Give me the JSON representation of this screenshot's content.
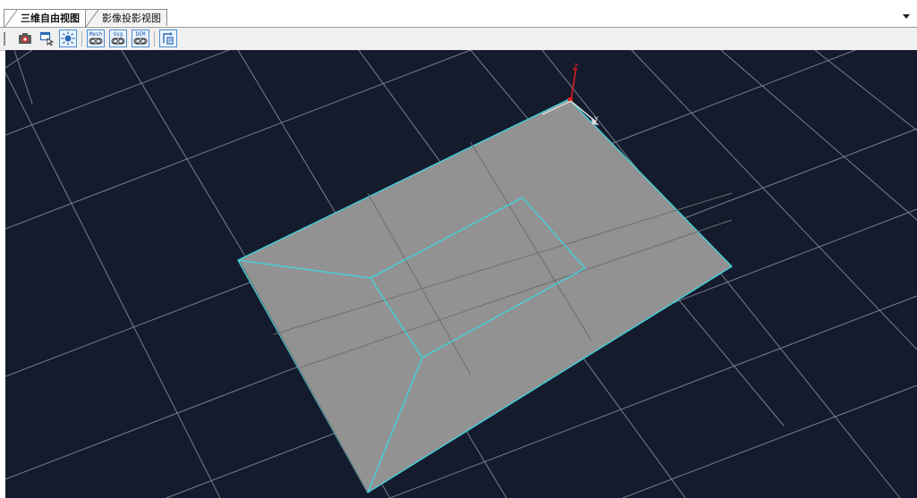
{
  "tabs": [
    {
      "label": "三维自由视图",
      "active": true
    },
    {
      "label": "影像投影视图",
      "active": false
    }
  ],
  "toolbar": {
    "buttons": [
      {
        "name": "snapshot-button",
        "icon": "camera-icon"
      },
      {
        "name": "select-button",
        "icon": "select-cursor-icon"
      },
      {
        "name": "light-button",
        "icon": "sun-icon"
      },
      {
        "name": "mesh-toggle-button",
        "icon": "toggle-icon",
        "label": "Mesh"
      },
      {
        "name": "osg-toggle-button",
        "icon": "toggle-icon",
        "label": "Osg"
      },
      {
        "name": "dem-toggle-button",
        "icon": "toggle-icon",
        "label": "DEM"
      },
      {
        "name": "rotate-view-button",
        "icon": "rotate-view-icon"
      }
    ]
  },
  "viewport": {
    "background_color": "#141b2d",
    "grid_color": "#8a8f99",
    "surface_color": "#929292",
    "edge_color": "#3fd4e0",
    "axis_colors": {
      "z": "#e02020",
      "x": "#dddddd",
      "y": "#dddddd"
    }
  }
}
